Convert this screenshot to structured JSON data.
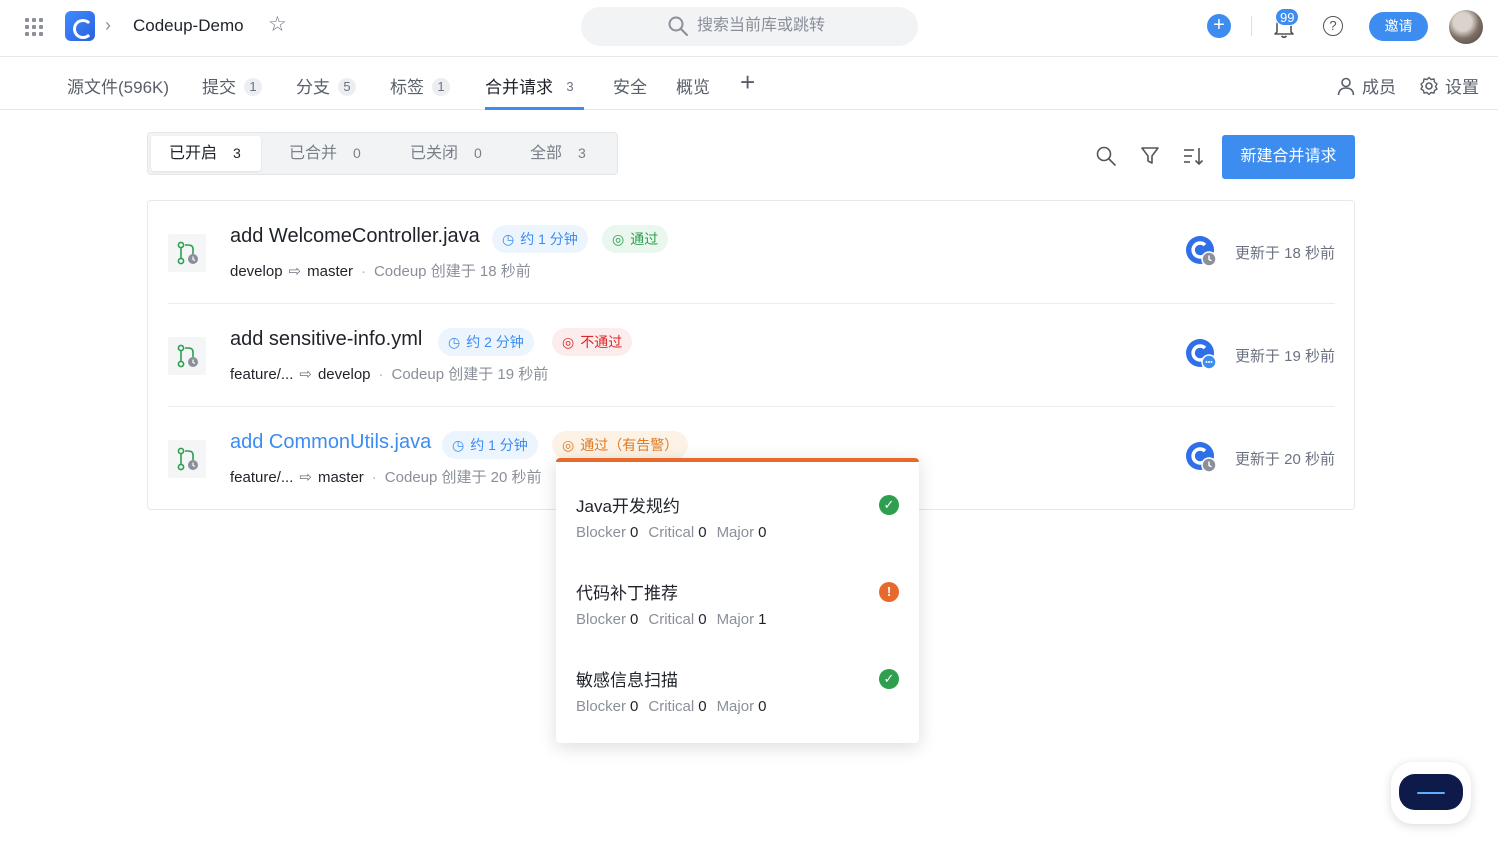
{
  "header": {
    "repo_name": "Codeup-Demo",
    "search_placeholder": "搜索当前库或跳转",
    "notification_count": "99",
    "invite_label": "邀请"
  },
  "nav": {
    "tabs": [
      {
        "label": "源文件(596K)",
        "count": ""
      },
      {
        "label": "提交",
        "count": "1"
      },
      {
        "label": "分支",
        "count": "5"
      },
      {
        "label": "标签",
        "count": "1"
      },
      {
        "label": "合并请求",
        "count": "3"
      },
      {
        "label": "安全",
        "count": ""
      },
      {
        "label": "概览",
        "count": ""
      }
    ],
    "active_tab": "合并请求",
    "members_label": "成员",
    "settings_label": "设置"
  },
  "filters": {
    "items": [
      {
        "label": "已开启",
        "count": "3"
      },
      {
        "label": "已合并",
        "count": "0"
      },
      {
        "label": "已关闭",
        "count": "0"
      },
      {
        "label": "全部",
        "count": "3"
      }
    ],
    "active": "已开启",
    "new_button_label": "新建合并请求"
  },
  "merge_requests": [
    {
      "title": "add WelcomeController.java",
      "duration": "约 1 分钟",
      "status": "通过",
      "source": "develop",
      "target": "master",
      "author": "Codeup",
      "created": "创建于 18 秒前",
      "updated": "更新于 18 秒前"
    },
    {
      "title": "add sensitive-info.yml",
      "duration": "约 2 分钟",
      "status": "不通过",
      "source": "feature/...",
      "target": "develop",
      "author": "Codeup",
      "created": "创建于 19 秒前",
      "updated": "更新于 19 秒前"
    },
    {
      "title": "add CommonUtils.java",
      "duration": "约 1 分钟",
      "status": "通过（有告警）",
      "source": "feature/...",
      "target": "master",
      "author": "Codeup",
      "created": "创建于 20 秒前",
      "updated": "更新于 20 秒前"
    }
  ],
  "popover": {
    "checks": [
      {
        "name": "Java开发规约",
        "blocker_label": "Blocker",
        "blocker": "0",
        "critical_label": "Critical",
        "critical": "0",
        "major_label": "Major",
        "major": "0",
        "status": "ok"
      },
      {
        "name": "代码补丁推荐",
        "blocker_label": "Blocker",
        "blocker": "0",
        "critical_label": "Critical",
        "critical": "0",
        "major_label": "Major",
        "major": "1",
        "status": "warn"
      },
      {
        "name": "敏感信息扫描",
        "blocker_label": "Blocker",
        "blocker": "0",
        "critical_label": "Critical",
        "critical": "0",
        "major_label": "Major",
        "major": "0",
        "status": "ok"
      }
    ]
  },
  "colors": {
    "accent": "#3d8cf0",
    "pass": "#2e9e4f",
    "fail": "#d92a2a",
    "warn": "#e8692c"
  }
}
